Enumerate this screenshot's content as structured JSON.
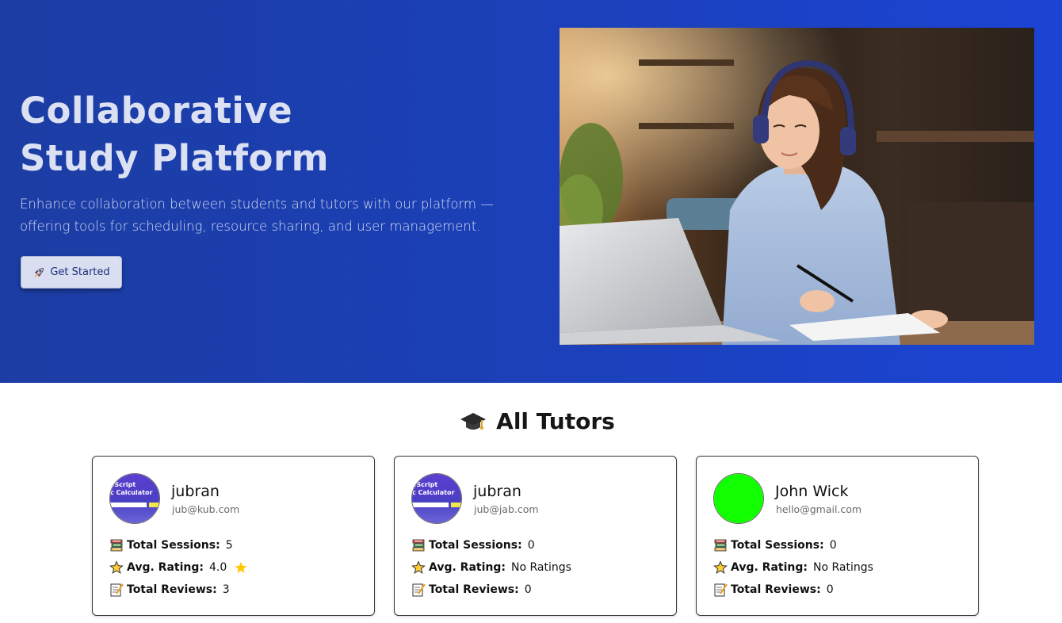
{
  "hero": {
    "title_line1": "Collaborative",
    "title_line2": "Study Platform",
    "description_line1": "Enhance collaboration between students and tutors with our platform —",
    "description_line2": "offering tools for scheduling, resource sharing, and user management.",
    "cta_label": "Get Started",
    "cta_icon": "rocket-icon",
    "image_description": "student-with-headphones-laptop-photo"
  },
  "tutors_section": {
    "title": "All Tutors",
    "title_icon": "graduation-cap-icon",
    "labels": {
      "sessions": "Total Sessions:",
      "rating": "Avg. Rating:",
      "reviews": "Total Reviews:"
    },
    "tutors": [
      {
        "name": "jubran",
        "email": "jub@kub.com",
        "avatar": "javascript-calculator-thumbnail",
        "avatar_text_1": "aScript",
        "avatar_text_2": "c Calculator",
        "sessions": "5",
        "rating": "4.0",
        "reviews": "3"
      },
      {
        "name": "jubran",
        "email": "jub@jab.com",
        "avatar": "javascript-calculator-thumbnail",
        "avatar_text_1": "aScript",
        "avatar_text_2": "c Calculator",
        "sessions": "0",
        "rating": "No Ratings",
        "reviews": "0"
      },
      {
        "name": "John Wick",
        "email": "hello@gmail.com",
        "avatar": "green-circle",
        "sessions": "0",
        "rating": "No Ratings",
        "reviews": "0"
      }
    ]
  },
  "colors": {
    "hero_bg": "#1c3da3",
    "hero_bg_right": "#1b44d4",
    "hero_text": "#dbe1f3",
    "button_bg": "#d9def0",
    "green_avatar": "#11ff00",
    "star_gold": "#ffc800"
  }
}
